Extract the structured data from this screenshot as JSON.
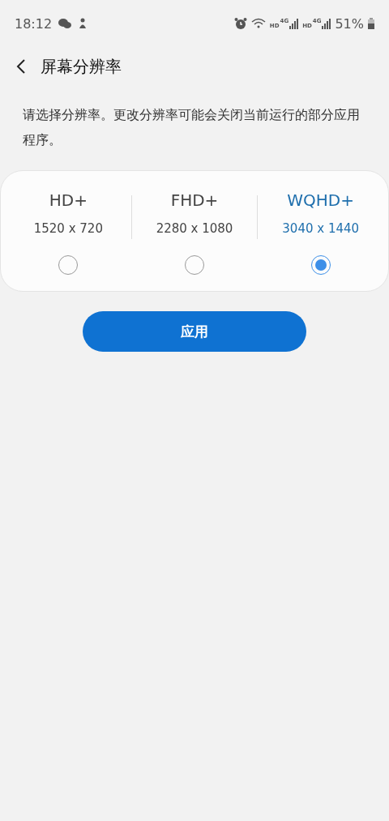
{
  "status_bar": {
    "time": "18:12",
    "networks": [
      {
        "hd": "HD",
        "gen": "4G"
      },
      {
        "hd": "HD",
        "gen": "4G"
      }
    ],
    "battery": "51%"
  },
  "header": {
    "title": "屏幕分辨率"
  },
  "description": "请选择分辨率。更改分辨率可能会关闭当前运行的部分应用程序。",
  "options": [
    {
      "name": "HD+",
      "resolution": "1520 x 720",
      "selected": false
    },
    {
      "name": "FHD+",
      "resolution": "2280 x 1080",
      "selected": false
    },
    {
      "name": "WQHD+",
      "resolution": "3040 x 1440",
      "selected": true
    }
  ],
  "apply_button": "应用"
}
